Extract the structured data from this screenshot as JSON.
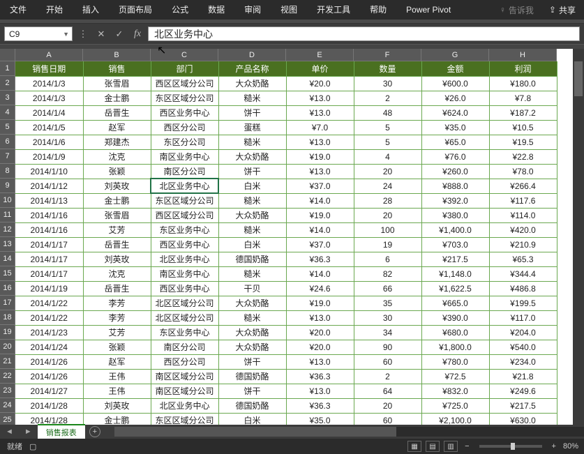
{
  "ribbon": {
    "tabs": [
      "文件",
      "开始",
      "插入",
      "页面布局",
      "公式",
      "数据",
      "审阅",
      "视图",
      "开发工具",
      "帮助",
      "Power Pivot"
    ],
    "search_placeholder": "告诉我",
    "share_label": "共享"
  },
  "namebox": {
    "value": "C9"
  },
  "formula": {
    "value": "北区业务中心"
  },
  "columns": [
    "A",
    "B",
    "C",
    "D",
    "E",
    "F",
    "G",
    "H"
  ],
  "row_numbers": [
    1,
    2,
    3,
    4,
    5,
    6,
    7,
    8,
    9,
    10,
    11,
    12,
    13,
    14,
    15,
    16,
    17,
    18,
    19,
    20,
    21,
    22,
    23,
    24,
    25
  ],
  "headers": [
    "销售日期",
    "销售",
    "部门",
    "产品名称",
    "单价",
    "数量",
    "金额",
    "利润"
  ],
  "rows": [
    {
      "c": [
        "2014/1/3",
        "张雪眉",
        "西区区域分公司",
        "大众奶酪",
        "¥20.0",
        "30",
        "¥600.0",
        "¥180.0"
      ]
    },
    {
      "c": [
        "2014/1/3",
        "金士鹏",
        "东区区域分公司",
        "糙米",
        "¥13.0",
        "2",
        "¥26.0",
        "¥7.8"
      ]
    },
    {
      "c": [
        "2014/1/4",
        "岳晋生",
        "西区业务中心",
        "饼干",
        "¥13.0",
        "48",
        "¥624.0",
        "¥187.2"
      ]
    },
    {
      "c": [
        "2014/1/5",
        "赵军",
        "西区分公司",
        "蛋糕",
        "¥7.0",
        "5",
        "¥35.0",
        "¥10.5"
      ]
    },
    {
      "c": [
        "2014/1/6",
        "郑建杰",
        "东区分公司",
        "糙米",
        "¥13.0",
        "5",
        "¥65.0",
        "¥19.5"
      ]
    },
    {
      "c": [
        "2014/1/9",
        "沈克",
        "南区业务中心",
        "大众奶酪",
        "¥19.0",
        "4",
        "¥76.0",
        "¥22.8"
      ]
    },
    {
      "c": [
        "2014/1/10",
        "张颖",
        "南区分公司",
        "饼干",
        "¥13.0",
        "20",
        "¥260.0",
        "¥78.0"
      ]
    },
    {
      "c": [
        "2014/1/12",
        "刘英玫",
        "北区业务中心",
        "白米",
        "¥37.0",
        "24",
        "¥888.0",
        "¥266.4"
      ]
    },
    {
      "c": [
        "2014/1/13",
        "金士鹏",
        "东区区域分公司",
        "糙米",
        "¥14.0",
        "28",
        "¥392.0",
        "¥117.6"
      ]
    },
    {
      "c": [
        "2014/1/16",
        "张雪眉",
        "西区区域分公司",
        "大众奶酪",
        "¥19.0",
        "20",
        "¥380.0",
        "¥114.0"
      ]
    },
    {
      "c": [
        "2014/1/16",
        "艾芳",
        "东区业务中心",
        "糙米",
        "¥14.0",
        "100",
        "¥1,400.0",
        "¥420.0"
      ]
    },
    {
      "c": [
        "2014/1/17",
        "岳晋生",
        "西区业务中心",
        "白米",
        "¥37.0",
        "19",
        "¥703.0",
        "¥210.9"
      ]
    },
    {
      "c": [
        "2014/1/17",
        "刘英玫",
        "北区业务中心",
        "德国奶酪",
        "¥36.3",
        "6",
        "¥217.5",
        "¥65.3"
      ]
    },
    {
      "c": [
        "2014/1/17",
        "沈克",
        "南区业务中心",
        "糙米",
        "¥14.0",
        "82",
        "¥1,148.0",
        "¥344.4"
      ]
    },
    {
      "c": [
        "2014/1/19",
        "岳晋生",
        "西区业务中心",
        "干贝",
        "¥24.6",
        "66",
        "¥1,622.5",
        "¥486.8"
      ]
    },
    {
      "c": [
        "2014/1/22",
        "李芳",
        "北区区域分公司",
        "大众奶酪",
        "¥19.0",
        "35",
        "¥665.0",
        "¥199.5"
      ]
    },
    {
      "c": [
        "2014/1/22",
        "李芳",
        "北区区域分公司",
        "糙米",
        "¥13.0",
        "30",
        "¥390.0",
        "¥117.0"
      ]
    },
    {
      "c": [
        "2014/1/23",
        "艾芳",
        "东区业务中心",
        "大众奶酪",
        "¥20.0",
        "34",
        "¥680.0",
        "¥204.0"
      ]
    },
    {
      "c": [
        "2014/1/24",
        "张颖",
        "南区分公司",
        "大众奶酪",
        "¥20.0",
        "90",
        "¥1,800.0",
        "¥540.0"
      ]
    },
    {
      "c": [
        "2014/1/26",
        "赵军",
        "西区分公司",
        "饼干",
        "¥13.0",
        "60",
        "¥780.0",
        "¥234.0"
      ]
    },
    {
      "c": [
        "2014/1/26",
        "王伟",
        "南区区域分公司",
        "德国奶酪",
        "¥36.3",
        "2",
        "¥72.5",
        "¥21.8"
      ]
    },
    {
      "c": [
        "2014/1/27",
        "王伟",
        "南区区域分公司",
        "饼干",
        "¥13.0",
        "64",
        "¥832.0",
        "¥249.6"
      ]
    },
    {
      "c": [
        "2014/1/28",
        "刘英玫",
        "北区业务中心",
        "德国奶酪",
        "¥36.3",
        "20",
        "¥725.0",
        "¥217.5"
      ]
    },
    {
      "c": [
        "2014/1/28",
        "金士鹏",
        "东区区域分公司",
        "白米",
        "¥35.0",
        "60",
        "¥2,100.0",
        "¥630.0"
      ]
    }
  ],
  "active_cell": {
    "row": 9,
    "col": 3
  },
  "sheet_tab": "销售报表",
  "status": {
    "mode": "就绪",
    "zoom": "80%"
  }
}
